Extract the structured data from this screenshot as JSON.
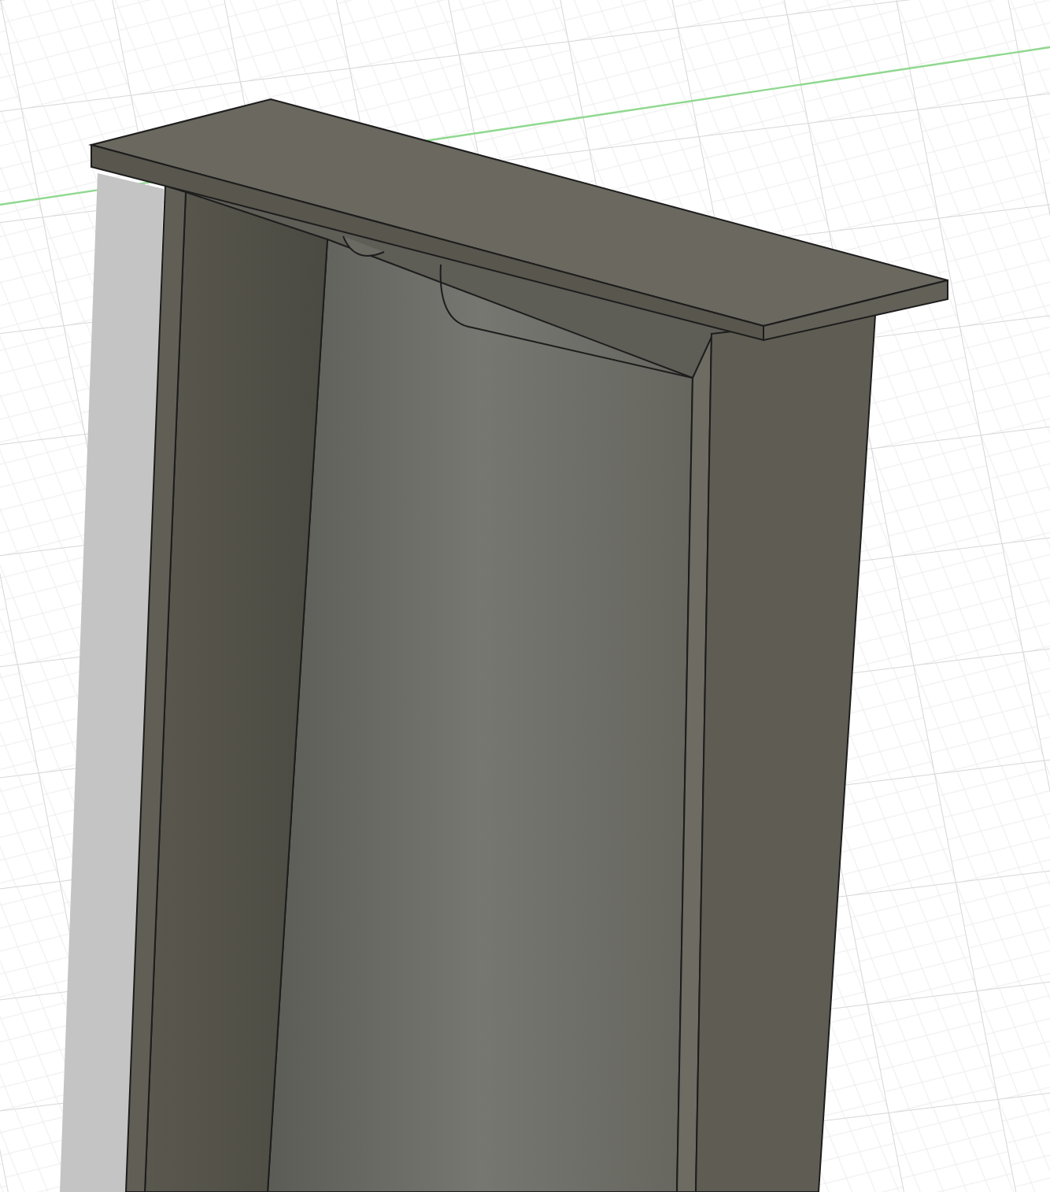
{
  "viewport": {
    "kind": "model",
    "grid": true
  }
}
